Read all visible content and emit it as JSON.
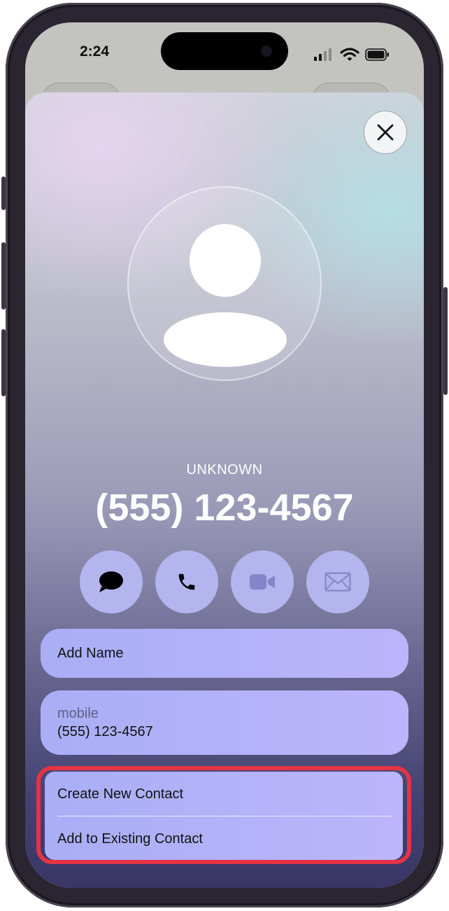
{
  "status_bar": {
    "time": "2:24",
    "icons": [
      "cellular-signal-icon",
      "wifi-icon",
      "battery-icon"
    ]
  },
  "close_icon": "close-icon",
  "caller": {
    "label": "UNKNOWN",
    "number": "(555) 123-4567"
  },
  "actions": [
    {
      "icon": "message-icon"
    },
    {
      "icon": "phone-icon"
    },
    {
      "icon": "video-icon"
    },
    {
      "icon": "mail-icon"
    }
  ],
  "fields": {
    "add_name": "Add Name",
    "phone_type": "mobile",
    "phone_value": "(555) 123-4567"
  },
  "options": {
    "create_new": "Create New Contact",
    "add_existing": "Add to Existing Contact"
  },
  "colors": {
    "highlight": "#e53345",
    "action_button": "#b4b4ee",
    "field_bg": "#b0b2f8"
  }
}
